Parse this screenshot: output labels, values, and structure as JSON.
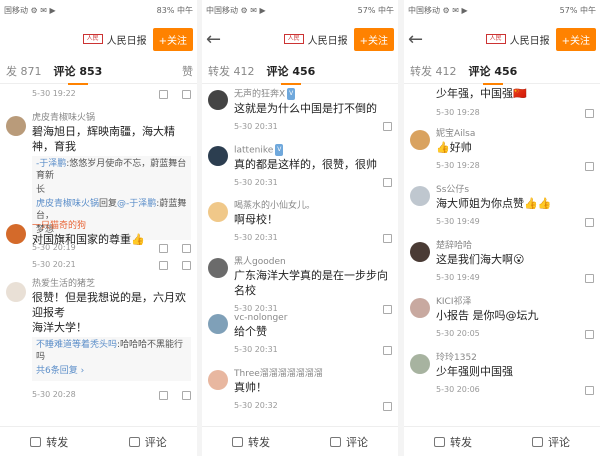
{
  "icons": {
    "back": "back-arrow-icon",
    "forward": "forward-icon",
    "comment": "comment-icon",
    "reply": "reply-icon"
  },
  "colors": {
    "accent": "#ff8200",
    "link": "#5b8ec9"
  },
  "panels": [
    {
      "status_left": "国移动 ⚙ ✉ ▶",
      "status_right": "83% 中午",
      "header": {
        "title": "人民日报",
        "follow": "+关注"
      },
      "tabs": {
        "repost": "发 871",
        "comment": "评论 853",
        "like": "赞"
      },
      "items": [
        {
          "time": "5-30 19:22"
        },
        {
          "name": "虎皮青椒味火锅",
          "text": "碧海旭日，辉映南疆，海大精神，育我",
          "reply1_name": "-于泽鹏",
          "reply1_text": ":悠悠岁月使命不忘，蔚蓝舞台育新",
          "reply1_text2": "长",
          "reply2_name": "虎皮青椒味火锅",
          "reply2_mid": "回复",
          "reply2_tag": "@-于泽鹏",
          "reply2_text": ":蔚蓝舞台，",
          "reply2_text2": "梦想",
          "time": "5-30 20:19"
        },
        {
          "name": "一只猫奇的狗",
          "text": "对国旗和国家的尊重👍",
          "time": "5-30 20:21"
        },
        {
          "name": "热爱生活的猪芝",
          "text": "很赞！但是我想说的是，六月欢迎报考",
          "text2": "海洋大学！",
          "reply1_name": "不睡难道等着秃头吗",
          "reply1_text": ":哈哈哈不黑能行吗",
          "more": "共6条回复 ›",
          "time": "5-30 20:28"
        },
        {
          "time": "5-30 20:28"
        }
      ],
      "bottom": {
        "repost": "转发",
        "comment": "评论"
      }
    },
    {
      "status_left": "中国移动 ⚙ ✉ ▶",
      "status_right": "57% 中午",
      "header": {
        "title": "人民日报",
        "follow": "+关注"
      },
      "tabs": {
        "repost": "转发 412",
        "comment": "评论 456"
      },
      "items": [
        {
          "name": "无声的狂奔X",
          "text": "这就是为什么中国是打不倒的",
          "time": "5-30 20:31"
        },
        {
          "name": "lattenike",
          "text": "真的都是这样的，很赞，很帅",
          "time": "5-30 20:31"
        },
        {
          "name": "喝蒸水的小仙女儿。",
          "text": "啊母校！",
          "time": "5-30 20:31"
        },
        {
          "name": "黑人gooden",
          "text": "广东海洋大学真的是在一步步向名校",
          "time": "5-30 20:31"
        },
        {
          "name": "vc-nolonger",
          "text": "给个赞",
          "time": "5-30 20:31"
        },
        {
          "name": "Three溜溜溜溜溜溜溜",
          "text": "真帅！",
          "time": "5-30 20:32"
        }
      ],
      "bottom": {
        "repost": "转发",
        "comment": "评论"
      }
    },
    {
      "status_left": "中国移动 ⚙ ✉ ▶",
      "status_right": "57% 中午",
      "header": {
        "title": "人民日报",
        "follow": "+关注"
      },
      "tabs": {
        "repost": "转发 412",
        "comment": "评论 456"
      },
      "items": [
        {
          "text": "少年强，中国强🇨🇳",
          "time": "5-30 19:28"
        },
        {
          "name": "妮宝Ailsa",
          "text": "👍好帅",
          "time": "5-30 19:28"
        },
        {
          "name": "Ss公仔s",
          "text": "海大师姐为你点赞👍👍",
          "time": "5-30 19:49"
        },
        {
          "name": "楚辞哈哈",
          "text": "这是我们海大啊😮",
          "time": "5-30 19:49"
        },
        {
          "name": "KICI祁泽",
          "text": "小报告 是你吗@坛九",
          "time": "5-30 20:05"
        },
        {
          "name": "玲玲1352",
          "text": "少年强则中国强",
          "time": "5-30 20:06"
        }
      ],
      "bottom": {
        "repost": "转发",
        "comment": "评论"
      }
    }
  ]
}
